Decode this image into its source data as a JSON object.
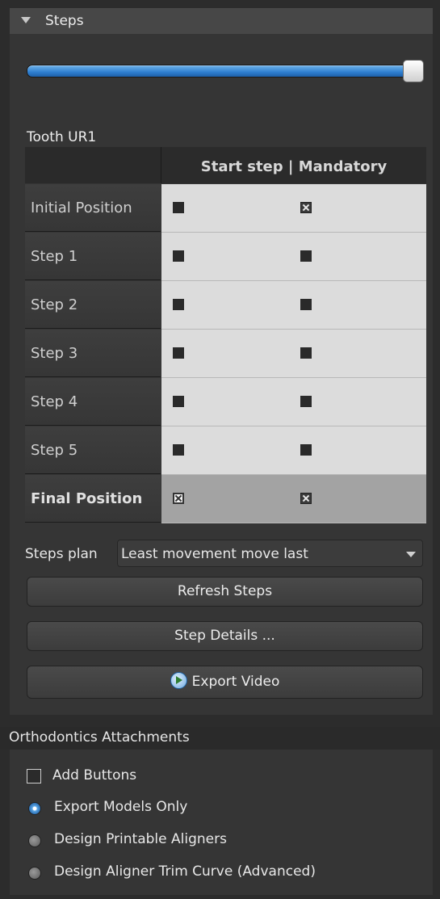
{
  "steps_section": {
    "title": "Steps"
  },
  "slider": {
    "value_fraction": 1.0
  },
  "tooth_label": "Tooth UR1",
  "table": {
    "column_header": "Start step | Mandatory",
    "rows": [
      {
        "label": "Initial Position",
        "start_step": false,
        "mandatory": true
      },
      {
        "label": "Step 1",
        "start_step": false,
        "mandatory": false
      },
      {
        "label": "Step 2",
        "start_step": false,
        "mandatory": false
      },
      {
        "label": "Step 3",
        "start_step": false,
        "mandatory": false
      },
      {
        "label": "Step 4",
        "start_step": false,
        "mandatory": false
      },
      {
        "label": "Step 5",
        "start_step": false,
        "mandatory": false
      },
      {
        "label": "Final Position",
        "start_step": true,
        "mandatory": true
      }
    ]
  },
  "steps_plan": {
    "label": "Steps plan",
    "value": "Least movement move last"
  },
  "buttons": {
    "refresh": "Refresh Steps",
    "details": "Step Details ...",
    "export_video": "Export Video"
  },
  "attachments": {
    "title": "Orthodontics Attachments",
    "add_buttons": {
      "label": "Add Buttons",
      "checked": false
    },
    "options": [
      {
        "label": "Export Models Only",
        "selected": true
      },
      {
        "label": "Design Printable Aligners",
        "selected": false
      },
      {
        "label": "Design Aligner Trim Curve (Advanced)",
        "selected": false
      }
    ]
  },
  "colors": {
    "accent": "#2e7fd0",
    "panel": "#353535",
    "table_cell": "#dcdcdc"
  },
  "icons": {
    "collapse": "triangle-down-icon",
    "video": "play-video-icon",
    "dropdown": "chevron-down-icon"
  }
}
